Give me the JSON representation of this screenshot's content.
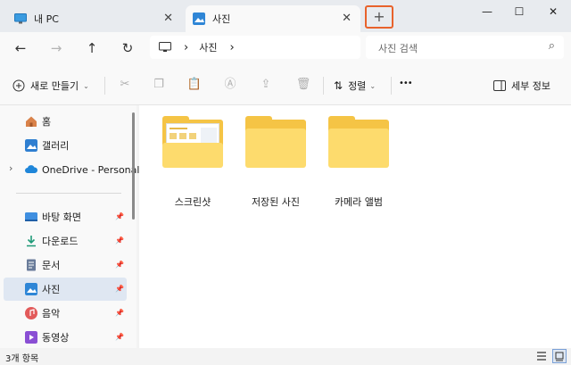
{
  "tabs": [
    {
      "label": "내 PC",
      "icon": "monitor-icon",
      "close": "✕"
    },
    {
      "label": "사진",
      "icon": "pictures-icon",
      "close": "✕"
    }
  ],
  "new_tab": {
    "label": "+"
  },
  "window_controls": {
    "minimize": "—",
    "maximize": "☐",
    "close": "✕"
  },
  "nav": {
    "back": "←",
    "forward": "→",
    "up": "↑",
    "refresh": "↻"
  },
  "address": {
    "sep1": "›",
    "current": "사진",
    "sep2": "›"
  },
  "search": {
    "placeholder": "사진 검색",
    "icon": "⌕"
  },
  "toolbar": {
    "new_label": "새로 만들기",
    "new_chevron": "⌄",
    "sort_label": "정렬",
    "sort_chevron": "⌄",
    "more": "•••",
    "details_label": "세부 정보"
  },
  "sidebar": {
    "items": [
      {
        "label": "홈",
        "icon": "home-icon",
        "color": "#d9824a",
        "pinned": false
      },
      {
        "label": "갤러리",
        "icon": "gallery-icon",
        "color": "#2f7fd1",
        "pinned": false
      },
      {
        "label": "OneDrive - Personal",
        "icon": "cloud-icon",
        "color": "#1f86d9",
        "pinned": false,
        "expandable": true
      },
      {
        "label": "바탕 화면",
        "icon": "desktop-icon",
        "color": "#3f8fe0",
        "pinned": true
      },
      {
        "label": "다운로드",
        "icon": "download-icon",
        "color": "#1f9a78",
        "pinned": true
      },
      {
        "label": "문서",
        "icon": "documents-icon",
        "color": "#6a7c9a",
        "pinned": true
      },
      {
        "label": "사진",
        "icon": "pictures-icon",
        "color": "#2f86d6",
        "pinned": true,
        "selected": true
      },
      {
        "label": "음악",
        "icon": "music-icon",
        "color": "#e25a5a",
        "pinned": true
      },
      {
        "label": "동영상",
        "icon": "video-icon",
        "color": "#8a4fd4",
        "pinned": true
      }
    ],
    "expand_chevron": "›",
    "pin_glyph": "📌"
  },
  "folders": [
    {
      "name": "스크린샷",
      "has_preview": true
    },
    {
      "name": "저장된 사진",
      "has_preview": false
    },
    {
      "name": "카메라 앨범",
      "has_preview": false
    }
  ],
  "status": {
    "count": "3개 항목"
  }
}
